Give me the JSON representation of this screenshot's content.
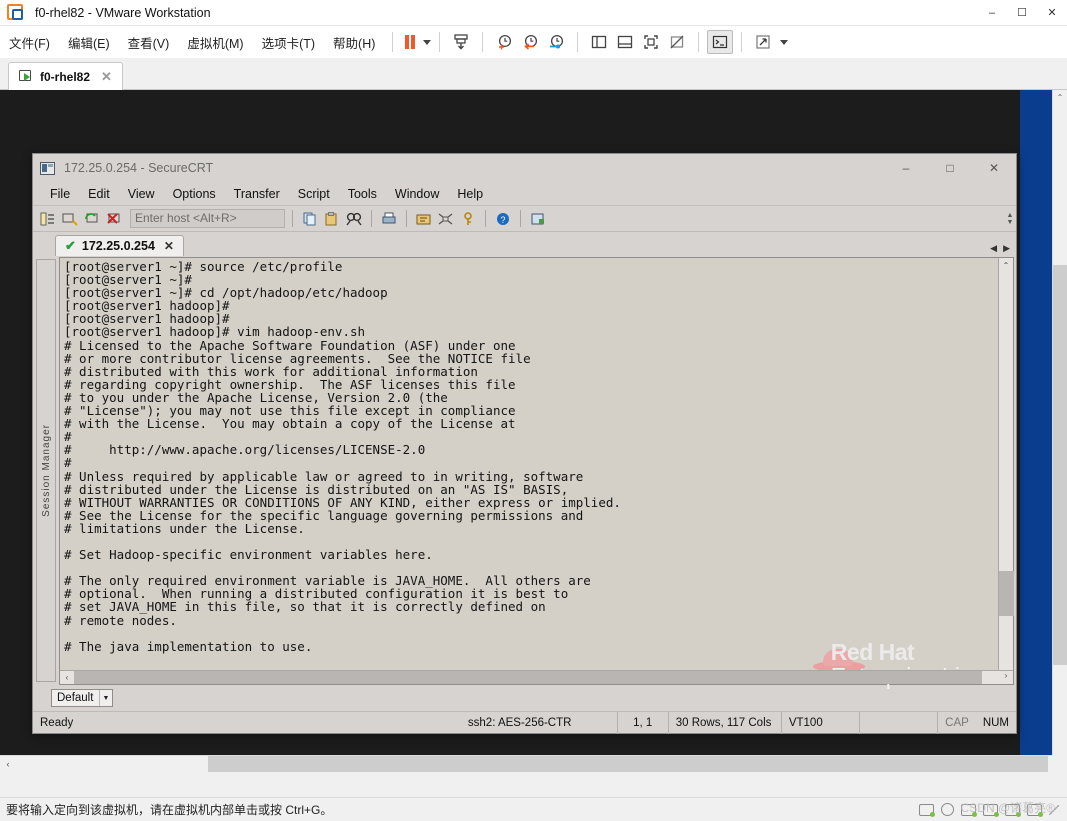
{
  "vmware": {
    "title": "f0-rhel82 - VMware Workstation",
    "window_buttons": {
      "minimize": "–",
      "maximize": "☐",
      "close": "✕"
    },
    "menus": [
      {
        "label": "文件(F)"
      },
      {
        "label": "编辑(E)"
      },
      {
        "label": "查看(V)"
      },
      {
        "label": "虚拟机(M)"
      },
      {
        "label": "选项卡(T)"
      },
      {
        "label": "帮助(H)"
      }
    ],
    "toolbar_icons": [
      "pause-icon",
      "dropdown-caret-icon",
      "send-ctrl-alt-del-icon",
      "take-snapshot-icon",
      "revert-snapshot-icon",
      "snapshot-manager-icon",
      "show-library-icon",
      "show-thumbnails-icon",
      "fullscreen-icon",
      "unity-mode-icon",
      "console-view-icon",
      "stretch-view-icon",
      "view-caret-icon"
    ],
    "tab": {
      "label": "f0-rhel82",
      "close": "✕"
    },
    "statusbar": {
      "message": "要将输入定向到该虚拟机，请在虚拟机内部单击或按 Ctrl+G。",
      "watermark": "CSDN @诸葛亮®"
    },
    "scroll": {
      "up": "⌃",
      "down": "⌄",
      "left": "‹"
    }
  },
  "securecrt": {
    "title": "172.25.0.254 - SecureCRT",
    "window_buttons": {
      "minimize": "–",
      "maximize": "□",
      "close": "✕"
    },
    "menus": [
      {
        "label": "File"
      },
      {
        "label": "Edit"
      },
      {
        "label": "View"
      },
      {
        "label": "Options"
      },
      {
        "label": "Transfer"
      },
      {
        "label": "Script"
      },
      {
        "label": "Tools"
      },
      {
        "label": "Window"
      },
      {
        "label": "Help"
      }
    ],
    "toolbar": {
      "host_placeholder": "Enter host <Alt+R>",
      "icons": [
        "session-manager-icon",
        "connect-icon",
        "reconnect-icon",
        "disconnect-icon",
        "copy-icon",
        "paste-icon",
        "find-icon",
        "print-icon",
        "log-session-icon",
        "transfer-icon",
        "key-icon",
        "help-icon",
        "properties-icon"
      ]
    },
    "session_manager_label": "Session Manager",
    "tab": {
      "label": "172.25.0.254",
      "check": "✔",
      "close": "✕"
    },
    "tab_nav": {
      "prev": "◀",
      "next": "▶"
    },
    "protocol_selector": {
      "value": "Default",
      "arrow": "▼"
    },
    "statusbar": {
      "ready": "Ready",
      "cipher": "ssh2: AES-256-CTR",
      "cursor": "1, 1",
      "dimensions": "30 Rows, 117 Cols",
      "emulation": "VT100",
      "blank": "",
      "cap": "CAP",
      "num": "NUM"
    },
    "watermark": {
      "line1": "Red Hat",
      "line2": "Enterprise Linux"
    },
    "terminal_lines": [
      "[root@server1 ~]# source /etc/profile",
      "[root@server1 ~]#",
      "[root@server1 ~]# cd /opt/hadoop/etc/hadoop",
      "[root@server1 hadoop]#",
      "[root@server1 hadoop]#",
      "[root@server1 hadoop]# vim hadoop-env.sh",
      "# Licensed to the Apache Software Foundation (ASF) under one",
      "# or more contributor license agreements.  See the NOTICE file",
      "# distributed with this work for additional information",
      "# regarding copyright ownership.  The ASF licenses this file",
      "# to you under the Apache License, Version 2.0 (the",
      "# \"License\"); you may not use this file except in compliance",
      "# with the License.  You may obtain a copy of the License at",
      "#",
      "#     http://www.apache.org/licenses/LICENSE-2.0",
      "#",
      "# Unless required by applicable law or agreed to in writing, software",
      "# distributed under the License is distributed on an \"AS IS\" BASIS,",
      "# WITHOUT WARRANTIES OR CONDITIONS OF ANY KIND, either express or implied.",
      "# See the License for the specific language governing permissions and",
      "# limitations under the License.",
      "",
      "# Set Hadoop-specific environment variables here.",
      "",
      "# The only required environment variable is JAVA_HOME.  All others are",
      "# optional.  When running a distributed configuration it is best to",
      "# set JAVA_HOME in this file, so that it is correctly defined on",
      "# remote nodes.",
      "",
      "# The java implementation to use."
    ]
  }
}
